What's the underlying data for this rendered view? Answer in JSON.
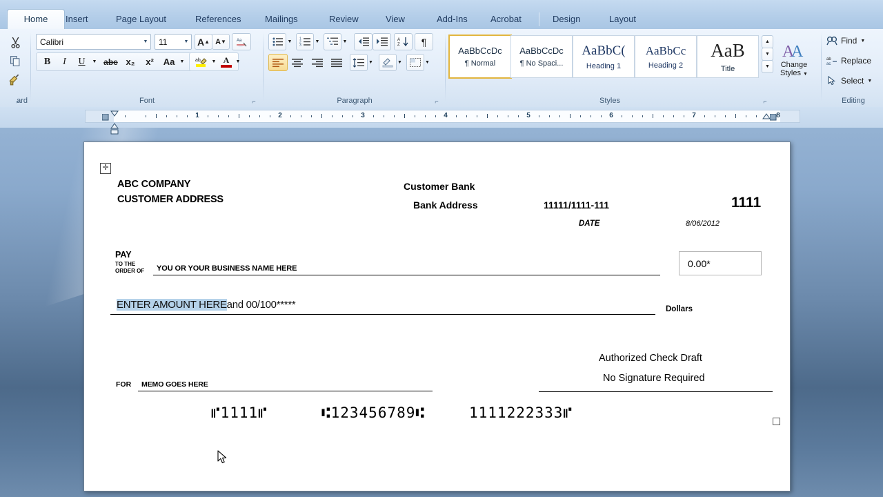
{
  "app": {
    "name": "Microsoft Word"
  },
  "tabs": [
    {
      "label": "Home",
      "active": true
    },
    {
      "label": "Insert",
      "active": false
    },
    {
      "label": "Page Layout",
      "active": false
    },
    {
      "label": "References",
      "active": false
    },
    {
      "label": "Mailings",
      "active": false
    },
    {
      "label": "Review",
      "active": false
    },
    {
      "label": "View",
      "active": false
    },
    {
      "label": "Add-Ins",
      "active": false
    },
    {
      "label": "Acrobat",
      "active": false
    },
    {
      "label": "Design",
      "active": false
    },
    {
      "label": "Layout",
      "active": false
    }
  ],
  "groups": {
    "clipboard": {
      "label": "ard",
      "full_label": "Clipboard"
    },
    "font": {
      "label": "Font",
      "font_name": "Calibri",
      "font_size": "11",
      "grow_font": "A",
      "shrink_font": "A",
      "clear_formatting": "Aa",
      "bold": "B",
      "italic": "I",
      "underline": "U",
      "strikethrough": "abc",
      "subscript": "x₂",
      "superscript": "x²",
      "change_case": "Aa",
      "highlight": "ab",
      "font_color": "A"
    },
    "paragraph": {
      "label": "Paragraph",
      "bullets": "bullets-icon",
      "numbering": "numbering-icon",
      "multilevel": "multilevel-list-icon",
      "decrease_indent": "decrease-indent-icon",
      "increase_indent": "increase-indent-icon",
      "sort": "sort-icon",
      "show_marks": "¶",
      "align_left": "align-left-icon",
      "align_center": "align-center-icon",
      "align_right": "align-right-icon",
      "justify": "justify-icon",
      "line_spacing": "line-spacing-icon",
      "shading": "shading-icon",
      "borders": "borders-icon"
    },
    "styles": {
      "label": "Styles",
      "items": [
        {
          "preview": "AaBbCcDc",
          "name": "¶ Normal",
          "selected": true,
          "serif": false
        },
        {
          "preview": "AaBbCcDc",
          "name": "¶ No Spaci...",
          "selected": false,
          "serif": false
        },
        {
          "preview": "AaBbC(",
          "name": "Heading 1",
          "selected": false,
          "serif": true
        },
        {
          "preview": "AaBbCc",
          "name": "Heading 2",
          "selected": false,
          "serif": true
        },
        {
          "preview": "AaB",
          "name": "Title",
          "selected": false,
          "serif": true
        }
      ],
      "change_styles": "Change\nStyles"
    },
    "editing": {
      "label": "Editing",
      "find": "Find",
      "replace": "Replace",
      "select": "Select"
    }
  },
  "ruler": {
    "numbers": [
      "1",
      "2",
      "3",
      "4",
      "5",
      "6",
      "7",
      "8"
    ],
    "unit": "inches"
  },
  "document": {
    "check": {
      "company_name": "ABC COMPANY",
      "company_address": "CUSTOMER ADDRESS",
      "bank_name": "Customer Bank",
      "bank_address": "Bank Address",
      "routing_fraction": "11111/1111-111",
      "check_number": "1111",
      "date_label": "DATE",
      "date_value": "8/06/2012",
      "pay_label": "PAY",
      "to_the_label": "TO THE",
      "order_of_label": "ORDER OF",
      "payee": "YOU OR YOUR BUSINESS NAME HERE",
      "amount_box": "0.00*",
      "amount_words_selected": "ENTER AMOUNT HERE",
      "amount_words_rest": "and 00/100*****",
      "dollars_label": "Dollars",
      "signature_line_1": "Authorized Check Draft",
      "signature_line_2": "No Signature Required",
      "for_label": "FOR",
      "memo": "MEMO GOES HERE",
      "micr_check_number": "⑈1111⑈",
      "micr_routing": "⑆123456789⑆",
      "micr_account": "1111222333⑈"
    }
  },
  "colors": {
    "selection_highlight": "#b5d2ea",
    "ribbon_accent": "#e2b53d",
    "tab_active_bg": "#fdfeff"
  }
}
